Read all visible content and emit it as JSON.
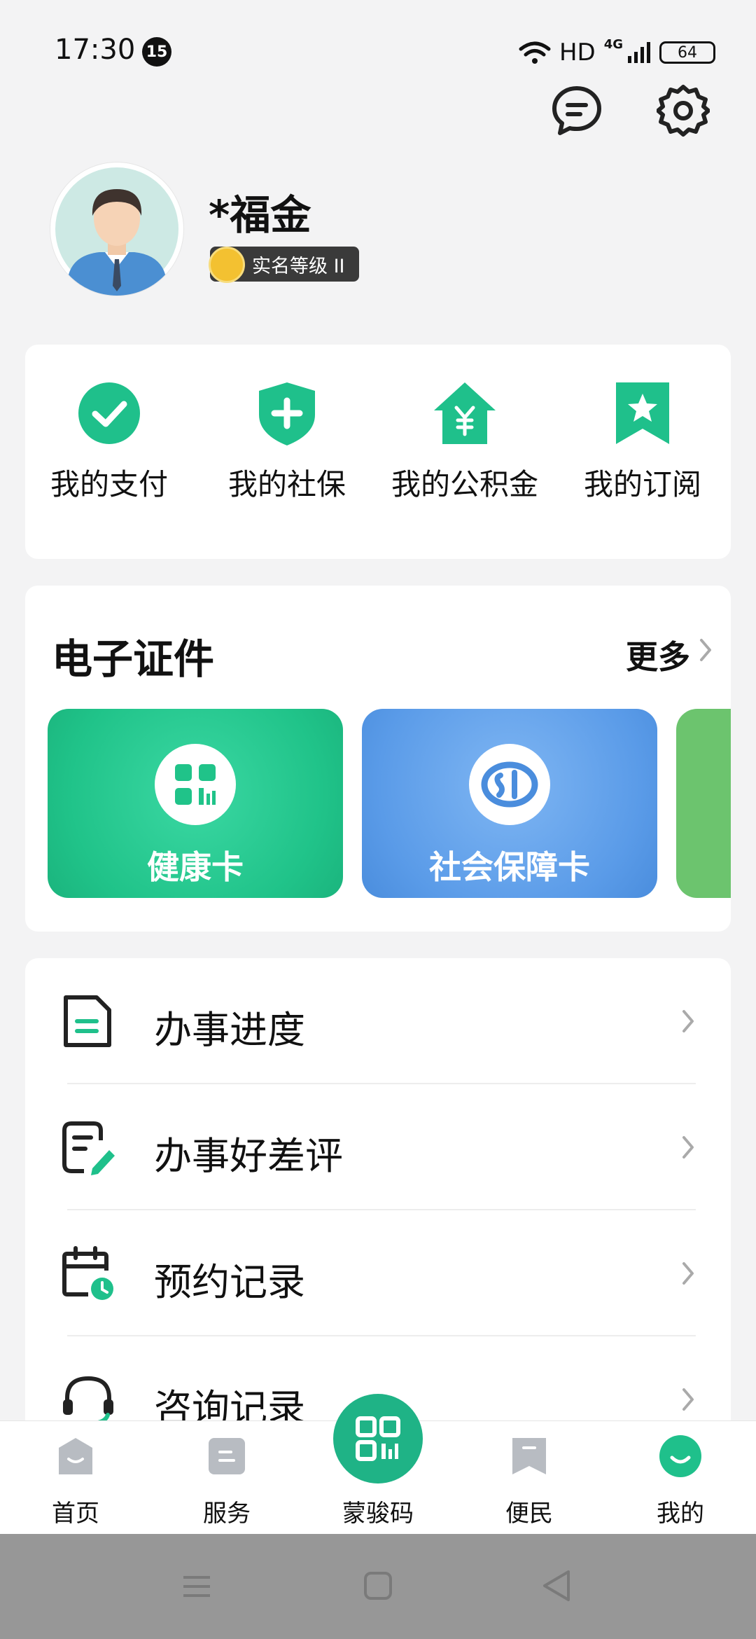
{
  "status_bar": {
    "time": "17:30",
    "notification_count": "15",
    "hd": "HD",
    "network": "4G",
    "battery": "64"
  },
  "header": {
    "message_icon": "message-icon",
    "settings_icon": "gear-icon"
  },
  "profile": {
    "name": "*福金",
    "verification_level": "实名等级 II"
  },
  "quick_actions": [
    {
      "label": "我的支付",
      "icon": "check-circle-icon"
    },
    {
      "label": "我的社保",
      "icon": "shield-plus-icon"
    },
    {
      "label": "我的公积金",
      "icon": "house-yen-icon"
    },
    {
      "label": "我的订阅",
      "icon": "bookmark-star-icon"
    }
  ],
  "certificates": {
    "title": "电子证件",
    "more": "更多",
    "cards": [
      {
        "label": "健康卡",
        "color": "#20c389"
      },
      {
        "label": "社会保障卡",
        "color": "#5a9be8"
      }
    ]
  },
  "records": [
    {
      "label": "办事进度",
      "icon": "document-icon"
    },
    {
      "label": "办事好差评",
      "icon": "review-edit-icon"
    },
    {
      "label": "预约记录",
      "icon": "calendar-clock-icon"
    },
    {
      "label": "咨询记录",
      "icon": "headset-icon"
    }
  ],
  "tabbar": {
    "home": "首页",
    "services": "服务",
    "scan": "蒙骏码",
    "convenience": "便民",
    "mine": "我的"
  },
  "colors": {
    "accent": "#1fc08b",
    "tab_inactive": "#b8bcc2",
    "background": "#f3f3f4"
  }
}
